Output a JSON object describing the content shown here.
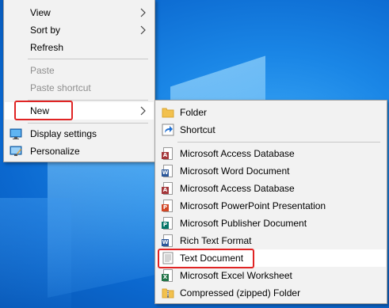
{
  "context_menu": {
    "items": [
      {
        "label": "View",
        "has_submenu": true
      },
      {
        "label": "Sort by",
        "has_submenu": true
      },
      {
        "label": "Refresh"
      },
      {
        "label": "Paste",
        "disabled": true
      },
      {
        "label": "Paste shortcut",
        "disabled": true
      },
      {
        "label": "New",
        "has_submenu": true,
        "highlighted": true
      },
      {
        "label": "Display settings",
        "icon": "display-settings-icon"
      },
      {
        "label": "Personalize",
        "icon": "personalize-icon"
      }
    ]
  },
  "new_submenu": {
    "items": [
      {
        "label": "Folder",
        "icon": "folder-icon"
      },
      {
        "label": "Shortcut",
        "icon": "shortcut-icon"
      },
      {
        "label": "Microsoft Access Database",
        "icon": "access-icon"
      },
      {
        "label": "Microsoft Word Document",
        "icon": "word-icon"
      },
      {
        "label": "Microsoft Access Database",
        "icon": "access-icon"
      },
      {
        "label": "Microsoft PowerPoint Presentation",
        "icon": "powerpoint-icon"
      },
      {
        "label": "Microsoft Publisher Document",
        "icon": "publisher-icon"
      },
      {
        "label": "Rich Text Format",
        "icon": "wordpad-icon"
      },
      {
        "label": "Text Document",
        "icon": "text-document-icon",
        "highlighted": true
      },
      {
        "label": "Microsoft Excel Worksheet",
        "icon": "excel-icon"
      },
      {
        "label": "Compressed (zipped) Folder",
        "icon": "zip-folder-icon"
      }
    ]
  },
  "colors": {
    "highlight_box": "#e02424",
    "menu_background": "#f2f2f2",
    "desktop": "#0b68cf"
  }
}
